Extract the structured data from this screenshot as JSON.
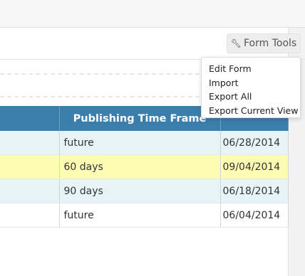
{
  "toolbar": {
    "form_tools_label": "Form Tools",
    "form_tools_icon": "wrench-icon"
  },
  "form_tools_menu": {
    "items": [
      "Edit Form",
      "Import",
      "Export All",
      "Export Current View"
    ]
  },
  "table": {
    "columns": [
      "",
      "Publishing Time Frame",
      ""
    ],
    "rows": [
      {
        "time_frame": "future",
        "date": "06/28/2014",
        "highlight": "#e6f4f8"
      },
      {
        "time_frame": "60 days",
        "date": "09/04/2014",
        "highlight": "#fdfcb3"
      },
      {
        "time_frame": "90 days",
        "date": "06/18/2014",
        "highlight": "#e6f4f8"
      },
      {
        "time_frame": "future",
        "date": "06/04/2014",
        "highlight": "#ffffff"
      }
    ]
  },
  "colors": {
    "header_bg": "#3b7dab",
    "row_blue": "#e6f4f8",
    "row_yellow": "#fdfcb3"
  }
}
